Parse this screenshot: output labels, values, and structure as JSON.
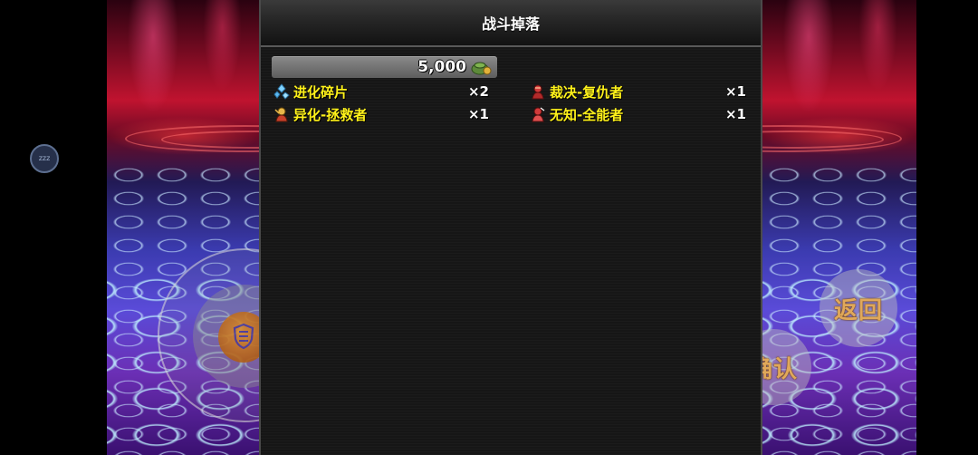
{
  "panel": {
    "title": "战斗掉落",
    "gold_amount": "5,000",
    "gold_icon": "money-bag-icon"
  },
  "drops": [
    {
      "name": "进化碎片",
      "qty": "×2",
      "icon": "crystal-shard-icon"
    },
    {
      "name": "裁决-复仇者",
      "qty": "×1",
      "icon": "red-figure-icon"
    },
    {
      "name": "异化-拯救者",
      "qty": "×1",
      "icon": "gold-figure-icon"
    },
    {
      "name": "无知-全能者",
      "qty": "×1",
      "icon": "red-figure-icon"
    }
  ],
  "side": {
    "idle_badge": "zzz",
    "back_button": "返回",
    "confirm_button": "确认"
  },
  "colors": {
    "item_name": "#fff21a",
    "button_text": "#e0a85a",
    "panel_bg": "#161616"
  }
}
